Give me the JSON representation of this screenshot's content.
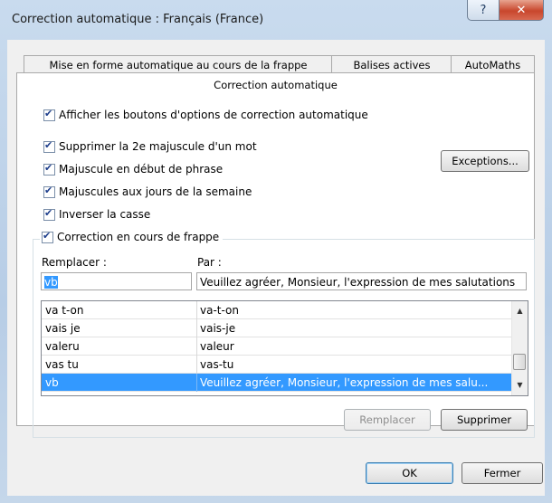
{
  "window": {
    "title": "Correction automatique : Français (France)",
    "help_label": "?",
    "close_label": "✕"
  },
  "tabs": [
    {
      "label": "Mise en forme automatique au cours de la frappe"
    },
    {
      "label": "Balises actives"
    },
    {
      "label": "AutoMaths"
    },
    {
      "label": "Correction automatique"
    }
  ],
  "options": {
    "show_buttons": {
      "label": "Afficher les boutons d'options de correction automatique",
      "checked": true
    },
    "two_initial_caps": {
      "label": "Supprimer la 2e majuscule d'un mot",
      "checked": true
    },
    "capitalize_sentences": {
      "label": "Majuscule en début de phrase",
      "checked": true
    },
    "capitalize_days": {
      "label": "Majuscules aux jours de la semaine",
      "checked": true
    },
    "caps_lock": {
      "label": "Inverser la casse",
      "checked": true
    },
    "replace_as_type": {
      "label": "Correction en cours de frappe",
      "checked": true
    }
  },
  "exceptions_label": "Exceptions...",
  "replace": {
    "replace_label": "Remplacer :",
    "with_label": "Par :",
    "replace_value": "vb",
    "with_value": "Veuillez agréer, Monsieur, l'expression de mes salutations"
  },
  "entries": [
    {
      "from": "va t-on",
      "to": "va-t-on"
    },
    {
      "from": "vais je",
      "to": "vais-je"
    },
    {
      "from": "valeru",
      "to": "valeur"
    },
    {
      "from": "vas tu",
      "to": "vas-tu"
    },
    {
      "from": "vb",
      "to": "Veuillez agréer, Monsieur, l'expression de mes salu..."
    }
  ],
  "selected_entry_index": 4,
  "buttons": {
    "replace": "Remplacer",
    "delete": "Supprimer",
    "ok": "OK",
    "close": "Fermer"
  },
  "colors": {
    "selection": "#3399ff",
    "checkmark": "#1c3d8b",
    "close_button": "#c8462c"
  }
}
